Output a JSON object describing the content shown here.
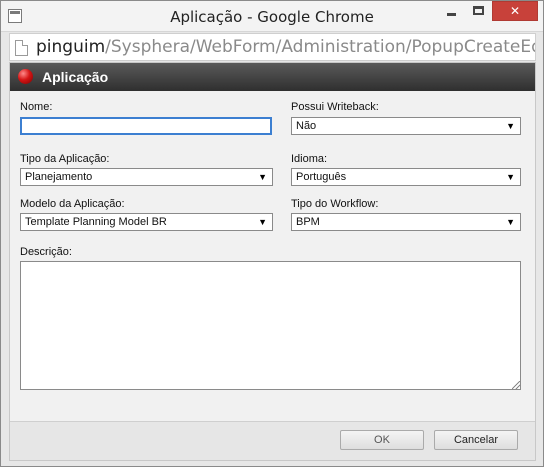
{
  "window": {
    "title": "Aplicação - Google Chrome",
    "close_glyph": "✕"
  },
  "address": {
    "host": "pinguim",
    "path": "/Sysphera/WebForm/Administration/PopupCreateEditApplicat"
  },
  "panel": {
    "title": "Aplicação"
  },
  "form": {
    "nome": {
      "label": "Nome:",
      "value": ""
    },
    "writeback": {
      "label": "Possui Writeback:",
      "value": "Não"
    },
    "tipo_aplicacao": {
      "label": "Tipo da Aplicação:",
      "value": "Planejamento"
    },
    "idioma": {
      "label": "Idioma:",
      "value": "Português"
    },
    "modelo": {
      "label": "Modelo da Aplicação:",
      "value": "Template Planning Model BR"
    },
    "workflow": {
      "label": "Tipo do Workflow:",
      "value": "BPM"
    },
    "descricao": {
      "label": "Descrição:",
      "value": ""
    },
    "dropdown_arrow": "▼"
  },
  "buttons": {
    "ok": "OK",
    "cancel": "Cancelar"
  },
  "colors": {
    "header_bg": "#3a3a3a",
    "close_button": "#c8413a",
    "focus_border": "#3c7fd1"
  }
}
